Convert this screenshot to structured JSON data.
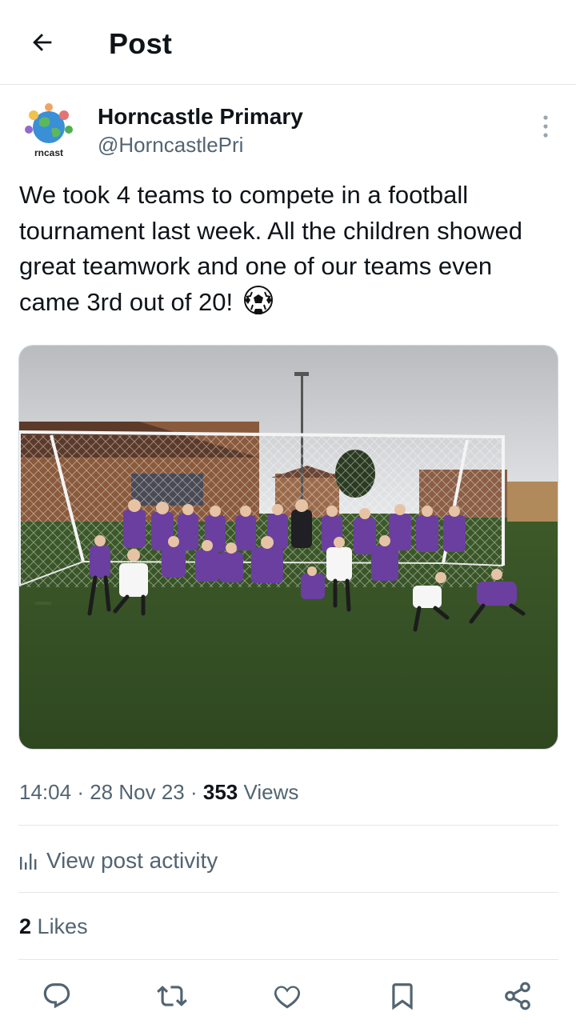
{
  "header": {
    "title": "Post"
  },
  "author": {
    "name": "Horncastle Primary",
    "handle": "@HorncastlePri",
    "avatar_text": "rncast"
  },
  "post": {
    "text": "We took 4 teams to compete in a football tournament last week. All the children showed great teamwork and one of our teams even came 3rd out of 20!",
    "emoji": "⚽"
  },
  "meta": {
    "time": "14:04",
    "date": "28 Nov 23",
    "views_count": "353",
    "views_label": "Views",
    "separator": "·"
  },
  "activity": {
    "label": "View post activity"
  },
  "likes": {
    "count": "2",
    "label": "Likes"
  },
  "icons": {
    "back": "arrow-left-icon",
    "more": "more-vertical-icon",
    "activity": "bar-chart-icon",
    "reply": "reply-icon",
    "repost": "repost-icon",
    "like": "heart-icon",
    "bookmark": "bookmark-icon",
    "share": "share-icon"
  },
  "colors": {
    "text": "#0f1419",
    "secondary": "#536471",
    "divider": "#e3e6e8"
  }
}
